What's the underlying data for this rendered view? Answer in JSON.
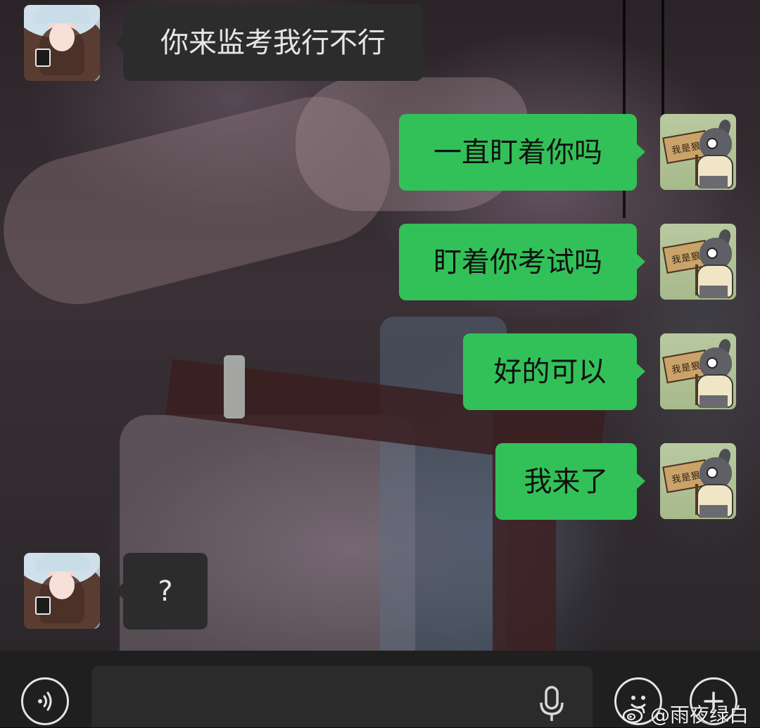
{
  "chat": {
    "messages": [
      {
        "side": "incoming",
        "sender": "contact",
        "text": "你来监考我行不行"
      },
      {
        "side": "outgoing",
        "sender": "me",
        "text": "一直盯着你吗"
      },
      {
        "side": "outgoing",
        "sender": "me",
        "text": "盯着你考试吗"
      },
      {
        "side": "outgoing",
        "sender": "me",
        "text": "好的可以"
      },
      {
        "side": "outgoing",
        "sender": "me",
        "text": "我来了"
      },
      {
        "side": "incoming",
        "sender": "contact",
        "text": "?"
      }
    ],
    "my_avatar_sign": "我是狠"
  },
  "input_bar": {
    "voice_icon": "voice-wave-icon",
    "mic_icon": "microphone-icon",
    "emoji_icon": "emoji-face-icon",
    "plus_icon": "plus-icon",
    "text_value": ""
  },
  "watermark": {
    "text": "@雨夜绿白",
    "icon": "weibo-logo-icon"
  },
  "colors": {
    "bubble_outgoing": "#32c158",
    "bubble_incoming": "#2c2c2c",
    "input_bar": "#1f1f1f"
  }
}
